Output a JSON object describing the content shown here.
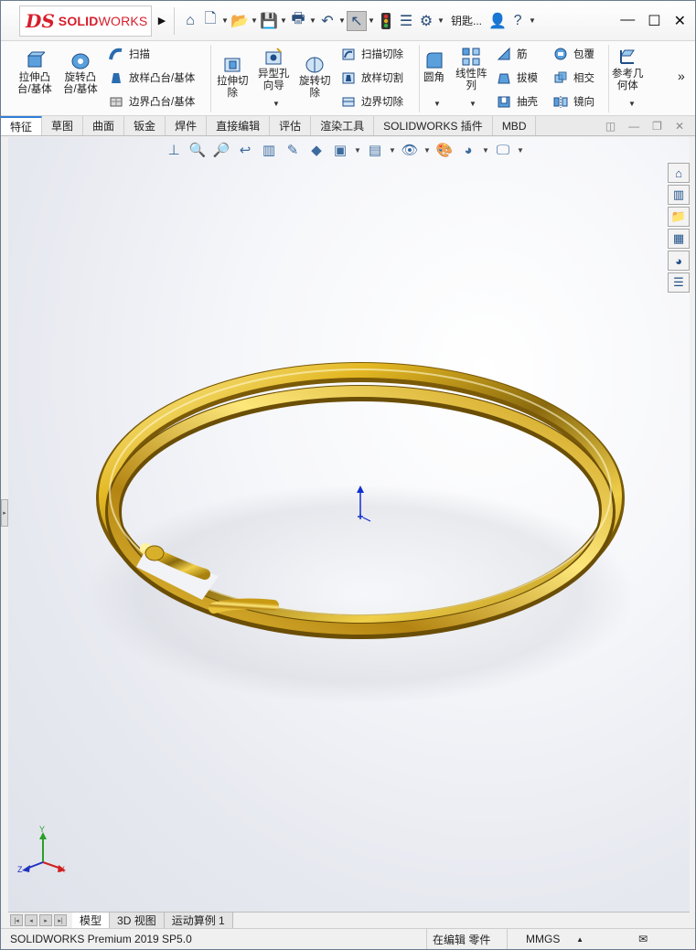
{
  "app": {
    "logo_mark": "DS",
    "logo_brand": "SOLID",
    "logo_brand2": "WORKS",
    "quick_access_more": "钥匙..."
  },
  "ribbon": {
    "extrude_boss": "拉伸凸\n台/基体",
    "revolve_boss": "旋转凸\n台/基体",
    "sweep": "扫描",
    "loft_boss": "放样凸台/基体",
    "boundary_boss": "边界凸台/基体",
    "extrude_cut": "拉伸切\n除",
    "hole_wizard": "异型孔\n向导",
    "revolve_cut": "旋转切\n除",
    "swept_cut": "扫描切除",
    "lofted_cut": "放样切割",
    "boundary_cut": "边界切除",
    "fillet": "圆角",
    "linear_pattern": "线性阵\n列",
    "rib": "筋",
    "draft": "拔模",
    "shell": "抽壳",
    "wrap": "包覆",
    "intersect": "相交",
    "mirror": "镜向",
    "ref_geometry": "参考几\n何体",
    "more": "»"
  },
  "tabs": [
    "特征",
    "草图",
    "曲面",
    "钣金",
    "焊件",
    "直接编辑",
    "评估",
    "渲染工具",
    "SOLIDWORKS 插件",
    "MBD"
  ],
  "bottom_tabs": [
    "模型",
    "3D 视图",
    "运动算例 1"
  ],
  "status": {
    "product": "SOLIDWORKS Premium 2019 SP5.0",
    "editing": "在编辑 零件",
    "units": "MMGS",
    "units_arrow": "▲"
  },
  "triad": {
    "x": "X",
    "y": "Y",
    "z": "Z"
  },
  "colors": {
    "accent": "#2f7ed8",
    "brand": "#d71e2b",
    "gold": "#d4a017"
  }
}
